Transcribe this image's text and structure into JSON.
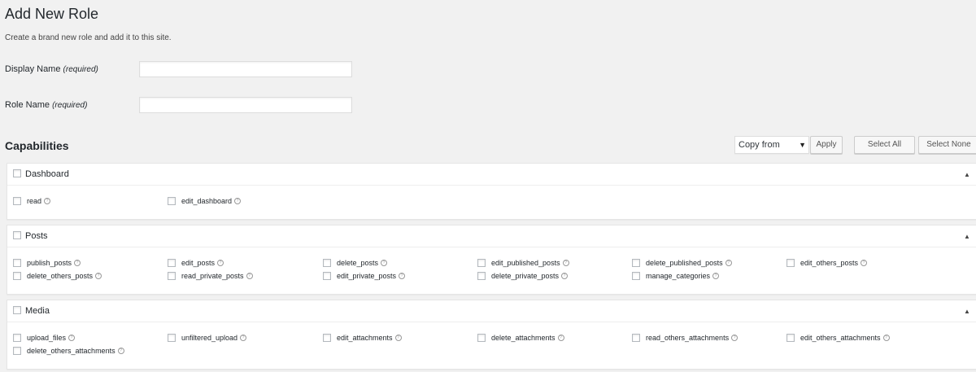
{
  "header": {
    "title": "Add New Role",
    "description": "Create a brand new role and add it to this site."
  },
  "form": {
    "display_name": {
      "label": "Display Name",
      "required": "(required)",
      "value": ""
    },
    "role_name": {
      "label": "Role Name",
      "required": "(required)",
      "value": ""
    }
  },
  "capabilities": {
    "title": "Capabilities",
    "copy_from": "Copy from",
    "apply_label": "Apply",
    "select_all_label": "Select All",
    "select_none_label": "Select None",
    "groups": [
      {
        "name": "Dashboard",
        "items": [
          "read",
          "edit_dashboard"
        ]
      },
      {
        "name": "Posts",
        "items": [
          "publish_posts",
          "edit_posts",
          "delete_posts",
          "edit_published_posts",
          "delete_published_posts",
          "edit_others_posts",
          "delete_others_posts",
          "read_private_posts",
          "edit_private_posts",
          "delete_private_posts",
          "manage_categories"
        ]
      },
      {
        "name": "Media",
        "items": [
          "upload_files",
          "unfiltered_upload",
          "edit_attachments",
          "delete_attachments",
          "read_others_attachments",
          "edit_others_attachments",
          "delete_others_attachments"
        ]
      }
    ]
  }
}
